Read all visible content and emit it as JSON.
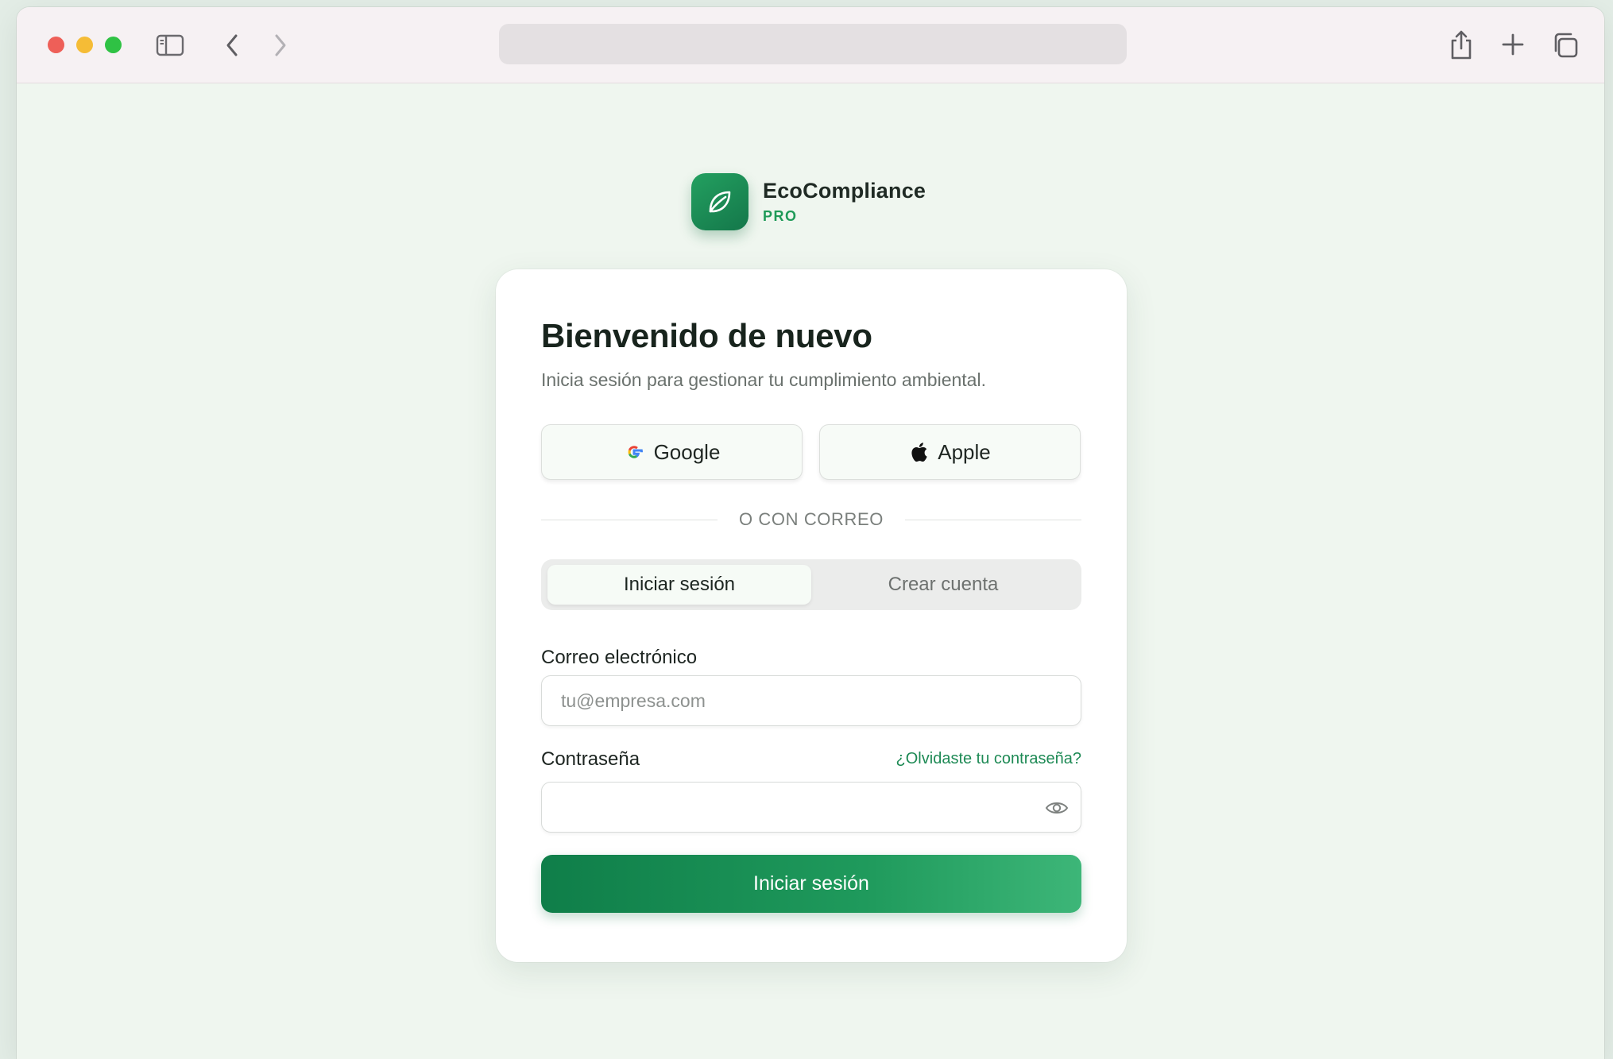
{
  "brand": {
    "name": "EcoCompliance",
    "tag": "PRO"
  },
  "login": {
    "title": "Bienvenido de nuevo",
    "subtitle": "Inicia sesión para gestionar tu cumplimiento ambiental.",
    "social": {
      "google_label": "Google",
      "apple_label": "Apple"
    },
    "divider_label": "O CON CORREO",
    "tabs": [
      {
        "label": "Iniciar sesión",
        "active": true
      },
      {
        "label": "Crear cuenta",
        "active": false
      }
    ],
    "email": {
      "label": "Correo electrónico",
      "placeholder": "tu@empresa.com"
    },
    "password": {
      "label": "Contraseña",
      "forgot_label": "¿Olvidaste tu contraseña?"
    },
    "submit_label": "Iniciar sesión"
  },
  "icons": {
    "sidebar": "sidebar-icon",
    "back": "chevron-left-icon",
    "forward": "chevron-right-icon",
    "share": "share-icon",
    "new_tab": "plus-icon",
    "tabs_overview": "tabs-icon",
    "logo": "leaf-icon",
    "google": "google-icon",
    "apple": "apple-icon",
    "show_password": "eye-icon"
  },
  "colors": {
    "accent": "#1e9a58",
    "page_background": "#eff6ef",
    "submit_gradient_start": "#0f7e49",
    "submit_gradient_end": "#3db678"
  }
}
